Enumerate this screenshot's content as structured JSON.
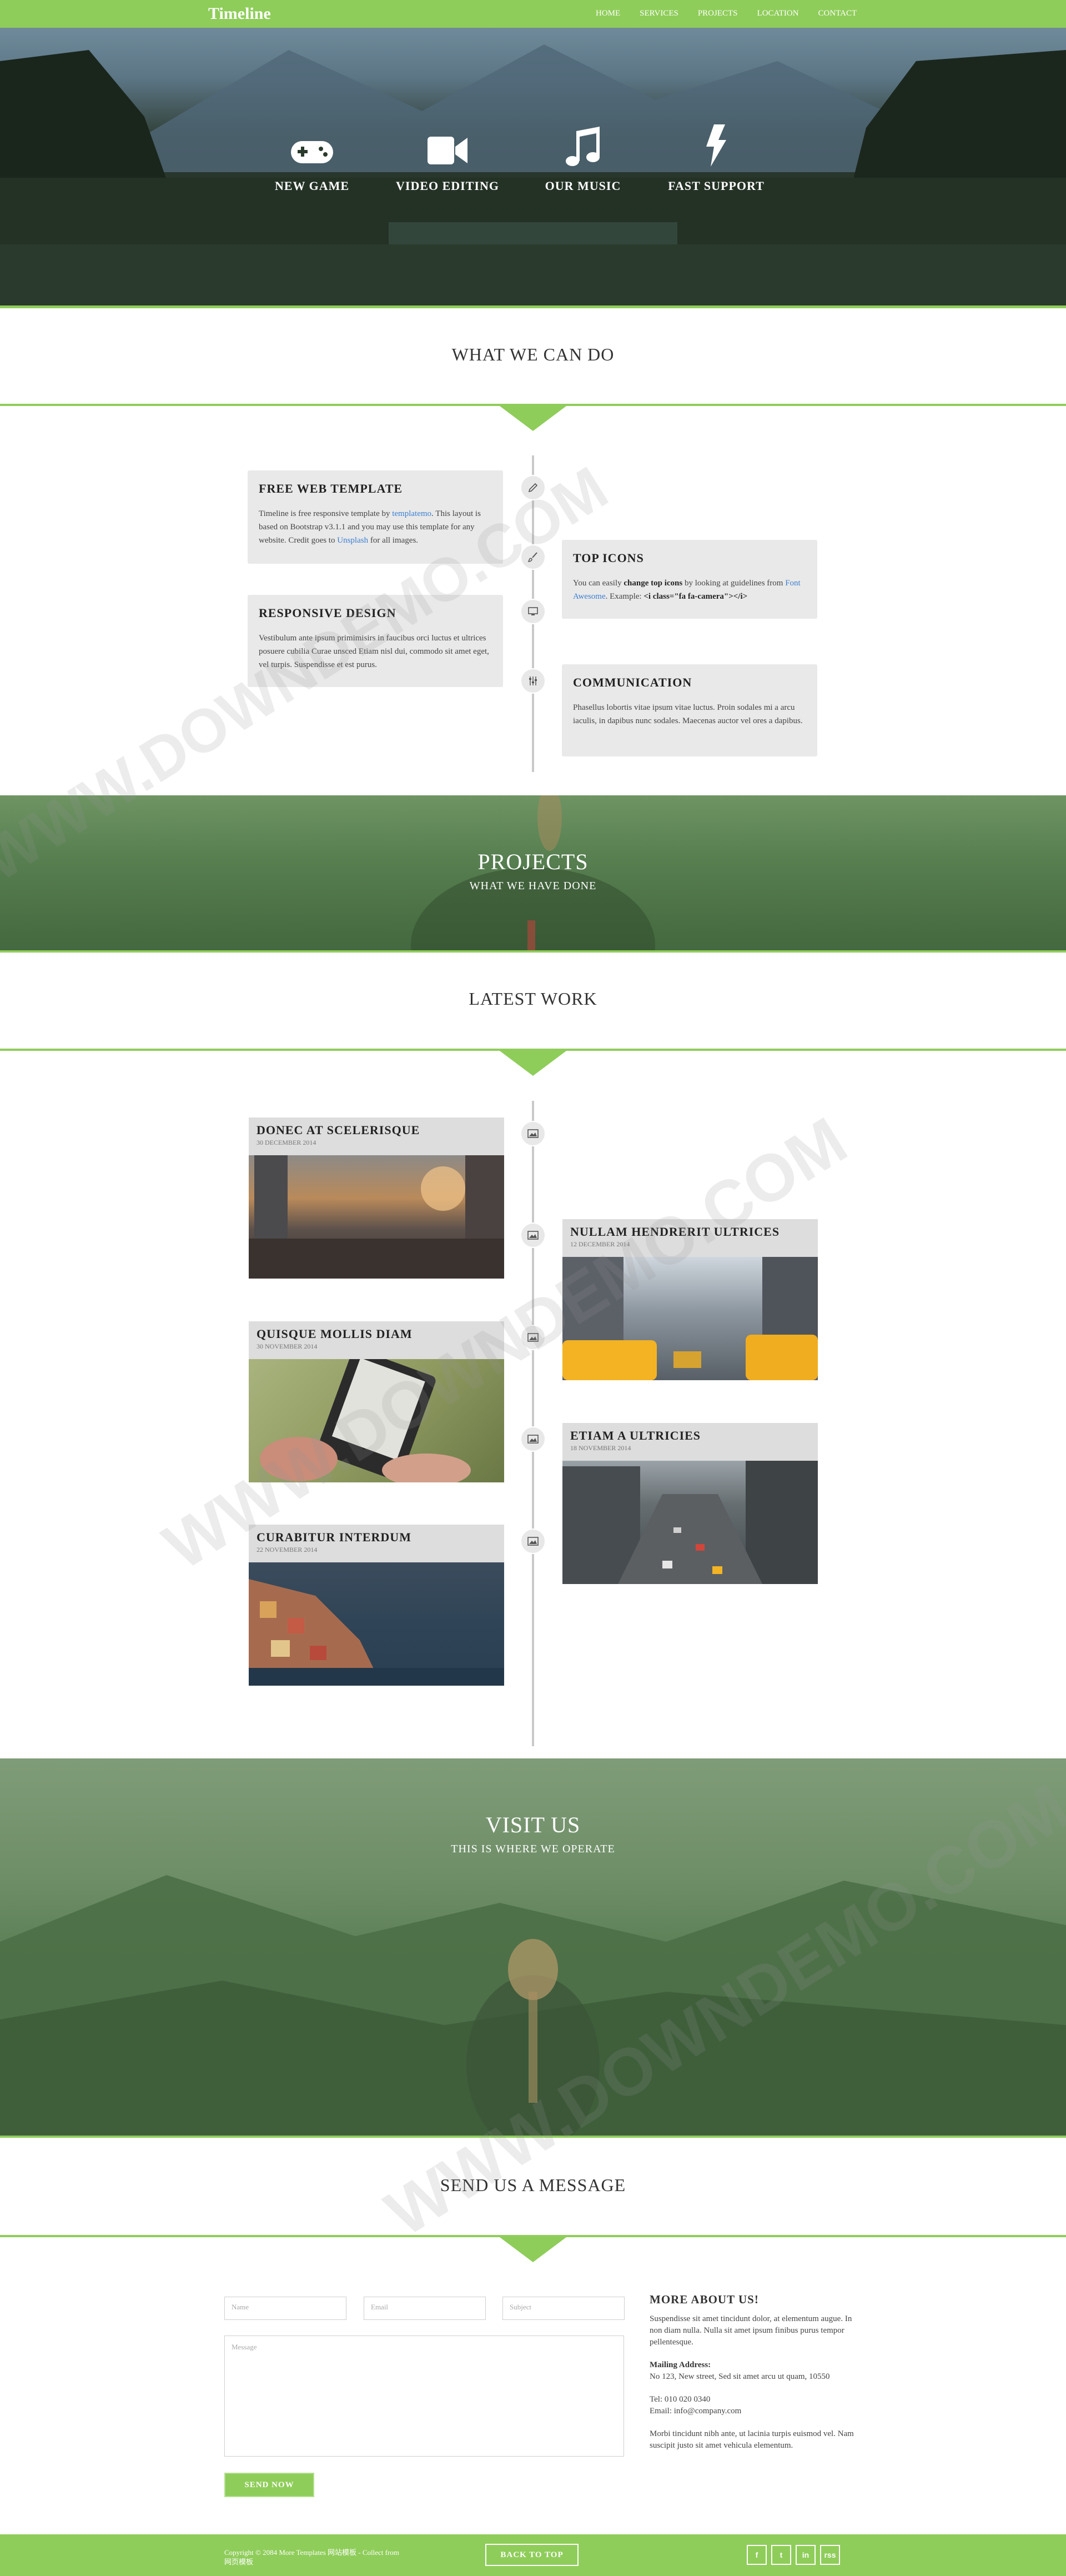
{
  "nav": {
    "brand": "Timeline",
    "links": [
      "HOME",
      "SERVICES",
      "PROJECTS",
      "LOCATION",
      "CONTACT"
    ]
  },
  "hero": {
    "features": [
      {
        "label": "NEW GAME",
        "icon": "gamepad-icon"
      },
      {
        "label": "VIDEO EDITING",
        "icon": "video-camera-icon"
      },
      {
        "label": "OUR MUSIC",
        "icon": "music-note-icon"
      },
      {
        "label": "FAST SUPPORT",
        "icon": "lightning-bolt-icon"
      }
    ]
  },
  "services": {
    "title": "WHAT WE CAN DO",
    "cards": [
      {
        "title": "FREE WEB TEMPLATE",
        "t1": "Timeline is free responsive template by ",
        "link1": "templatemo",
        "t2": ". This layout is based on Bootstrap v3.1.1 and you may use this template for any website. Credit goes to ",
        "link2": "Unsplash",
        "t3": " for all images.",
        "icon": "pencil-icon"
      },
      {
        "title": "TOP ICONS",
        "t1": "You can easily ",
        "bold1": "change top icons",
        "t2": " by looking at guidelines from ",
        "link1": "Font Awesome",
        "t3": ". Example: ",
        "bold2": "<i class=\"fa fa-camera\"></i>",
        "icon": "brush-icon"
      },
      {
        "title": "RESPONSIVE DESIGN",
        "text": "Vestibulum ante ipsum primimisirs in faucibus orci luctus et ultrices posuere cubilia Curae unsced Etiam nisl dui, commodo sit amet eget, vel turpis. Suspendisse et est purus.",
        "icon": "monitor-icon"
      },
      {
        "title": "COMMUNICATION",
        "text": "Phasellus lobortis vitae ipsum vitae luctus. Proin sodales mi a arcu iaculis, in dapibus nunc sodales. Maecenas auctor vel ores a dapibus.",
        "icon": "sliders-icon"
      }
    ]
  },
  "projects_banner": {
    "title": "PROJECTS",
    "subtitle": "WHAT WE HAVE DONE"
  },
  "work": {
    "title": "LATEST WORK",
    "items": [
      {
        "title": "DONEC AT SCELERISQUE",
        "date": "30 DECEMBER 2014"
      },
      {
        "title": "NULLAM HENDRERIT ULTRICES",
        "date": "12 DECEMBER 2014"
      },
      {
        "title": "QUISQUE MOLLIS DIAM",
        "date": "30 NOVEMBER 2014"
      },
      {
        "title": "ETIAM A ULTRICIES",
        "date": "18 NOVEMBER 2014"
      },
      {
        "title": "CURABITUR INTERDUM",
        "date": "22 NOVEMBER 2014"
      }
    ]
  },
  "visit_banner": {
    "title": "VISIT US",
    "subtitle": "THIS IS WHERE WE OPERATE"
  },
  "contact": {
    "title": "SEND US A MESSAGE",
    "name_placeholder": "Name",
    "email_placeholder": "Email",
    "subject_placeholder": "Subject",
    "message_placeholder": "Message",
    "send_label": "SEND NOW",
    "info_title": "MORE ABOUT US!",
    "info_text": "Suspendisse sit amet tincidunt dolor, at elementum augue. In non diam nulla. Nulla sit amet ipsum finibus purus tempor pellentesque.",
    "mailing_label": "Mailing Address:",
    "address": "No 123, New street, Sed sit amet arcu ut quam, 10550",
    "tel": "Tel: 010 020 0340",
    "email": "Email: info@company.com",
    "footer_text": "Morbi tincidunt nibh ante, ut lacinia turpis euismod vel. Nam suscipit justo sit amet vehicula elementum."
  },
  "footer": {
    "copyright_line1": "Copyright © 2084 More Templates 网站模板 - Collect from",
    "copyright_line2": "网页模板",
    "back_to_top": "BACK TO TOP",
    "socials": [
      "f",
      "t",
      "in",
      "rss"
    ]
  },
  "watermark": "WWW.DOWNDEMO.COM",
  "colors": {
    "accent": "#8fcd5a",
    "card": "#e9e9e9",
    "link": "#3b7fd1"
  }
}
